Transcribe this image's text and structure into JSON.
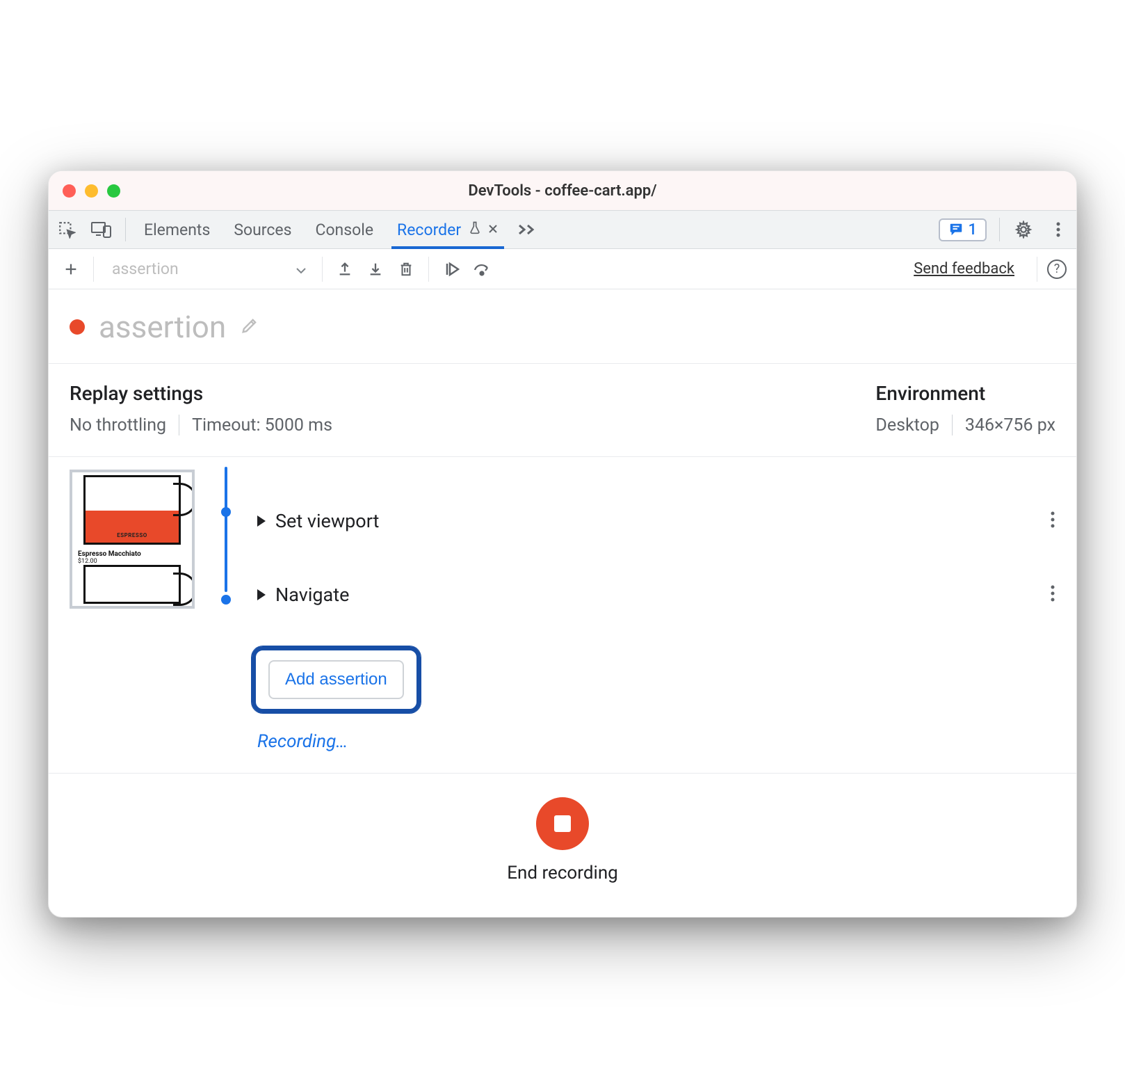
{
  "window": {
    "title": "DevTools - coffee-cart.app/"
  },
  "tabs": {
    "items": [
      "Elements",
      "Sources",
      "Console",
      "Recorder"
    ],
    "active_index": 3
  },
  "issues_badge": {
    "count": "1"
  },
  "toolbar": {
    "recording_select": {
      "value": "assertion"
    },
    "feedback_link": "Send feedback"
  },
  "heading": {
    "title": "assertion"
  },
  "replay_settings": {
    "heading": "Replay settings",
    "throttling": "No throttling",
    "timeout": "Timeout: 5000 ms"
  },
  "environment": {
    "heading": "Environment",
    "device": "Desktop",
    "viewport": "346×756 px"
  },
  "thumbnail": {
    "product_name": "Espresso Macchiato",
    "price": "$12.00",
    "cup_label": "ESPRESSO"
  },
  "steps": [
    {
      "label": "Set viewport"
    },
    {
      "label": "Navigate"
    }
  ],
  "add_assertion_label": "Add assertion",
  "recording_status": "Recording…",
  "footer": {
    "end_label": "End recording"
  }
}
